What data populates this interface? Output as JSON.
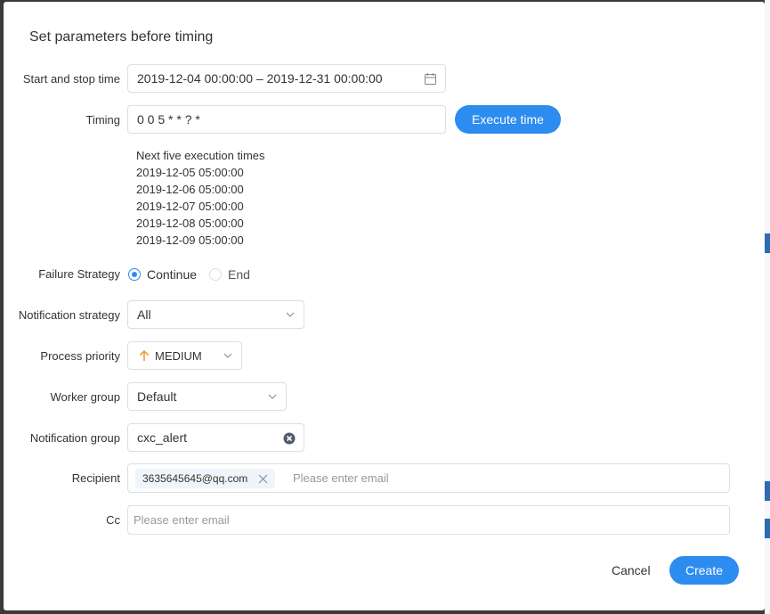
{
  "dialog": {
    "title": "Set parameters before timing"
  },
  "fields": {
    "start_stop": {
      "label": "Start and stop time",
      "value": "2019-12-04 00:00:00 – 2019-12-31 00:00:00"
    },
    "timing": {
      "label": "Timing",
      "value": "0 0 5 * * ? *",
      "execute_button": "Execute time"
    },
    "execution_times": {
      "heading": "Next five execution times",
      "items": [
        "2019-12-05 05:00:00",
        "2019-12-06 05:00:00",
        "2019-12-07 05:00:00",
        "2019-12-08 05:00:00",
        "2019-12-09 05:00:00"
      ]
    },
    "failure_strategy": {
      "label": "Failure Strategy",
      "options": [
        "Continue",
        "End"
      ],
      "selected": "Continue"
    },
    "notification_strategy": {
      "label": "Notification strategy",
      "value": "All"
    },
    "process_priority": {
      "label": "Process priority",
      "value": "MEDIUM",
      "icon_color": "#f29c38"
    },
    "worker_group": {
      "label": "Worker group",
      "value": "Default"
    },
    "notification_group": {
      "label": "Notification group",
      "value": "cxc_alert"
    },
    "recipient": {
      "label": "Recipient",
      "tag": "3635645645@qq.com",
      "placeholder": "Please enter email"
    },
    "cc": {
      "label": "Cc",
      "placeholder": "Please enter email"
    }
  },
  "footer": {
    "cancel": "Cancel",
    "create": "Create"
  },
  "colors": {
    "primary": "#2d8cf0"
  }
}
